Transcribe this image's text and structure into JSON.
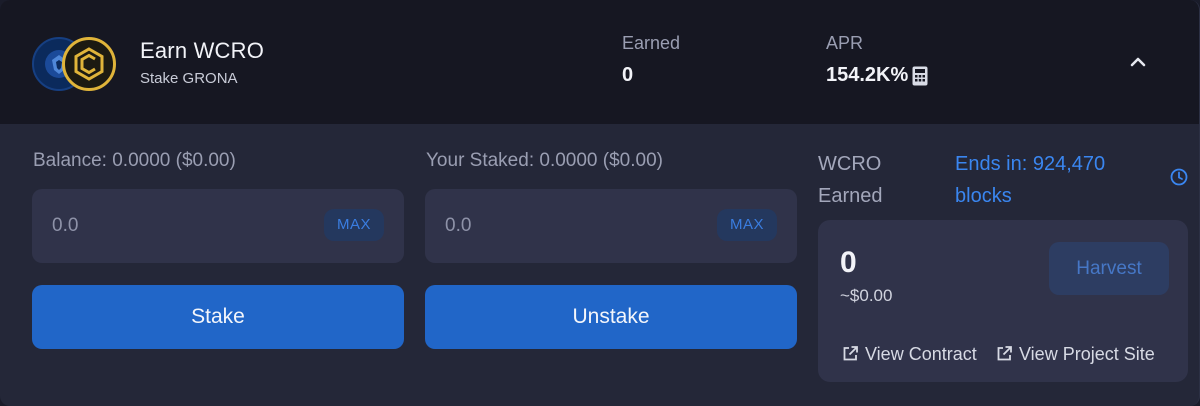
{
  "pool": {
    "title": "Earn WCRO",
    "subtitle": "Stake GRONA"
  },
  "stats": {
    "earned_label": "Earned",
    "earned_value": "0",
    "apr_label": "APR",
    "apr_value": "154.2K%"
  },
  "stake": {
    "balance_label": "Balance: 0.0000 ($0.00)",
    "input_placeholder": "0.0",
    "max_label": "MAX",
    "button_label": "Stake"
  },
  "unstake": {
    "staked_label": "Your Staked: 0.0000 ($0.00)",
    "input_placeholder": "0.0",
    "max_label": "MAX",
    "button_label": "Unstake"
  },
  "rewards": {
    "earned_label": "WCRO Earned",
    "ends_in": "Ends in: 924,470 blocks",
    "amount": "0",
    "amount_usd": "~$0.00",
    "harvest_label": "Harvest",
    "view_contract_label": "View Contract",
    "view_project_label": "View Project Site"
  },
  "icons": {
    "logo_left": "cronos-lion-logo",
    "logo_right": "wcro-logo",
    "calculator": "calculator-icon",
    "collapse": "chevron-up-icon",
    "clock": "clock-icon",
    "external_link": "external-link-icon"
  },
  "colors": {
    "accent": "#2166c8",
    "link": "#3a86f0",
    "logo_gold": "#e0b43a",
    "logo_blue": "#0b2a5c"
  }
}
